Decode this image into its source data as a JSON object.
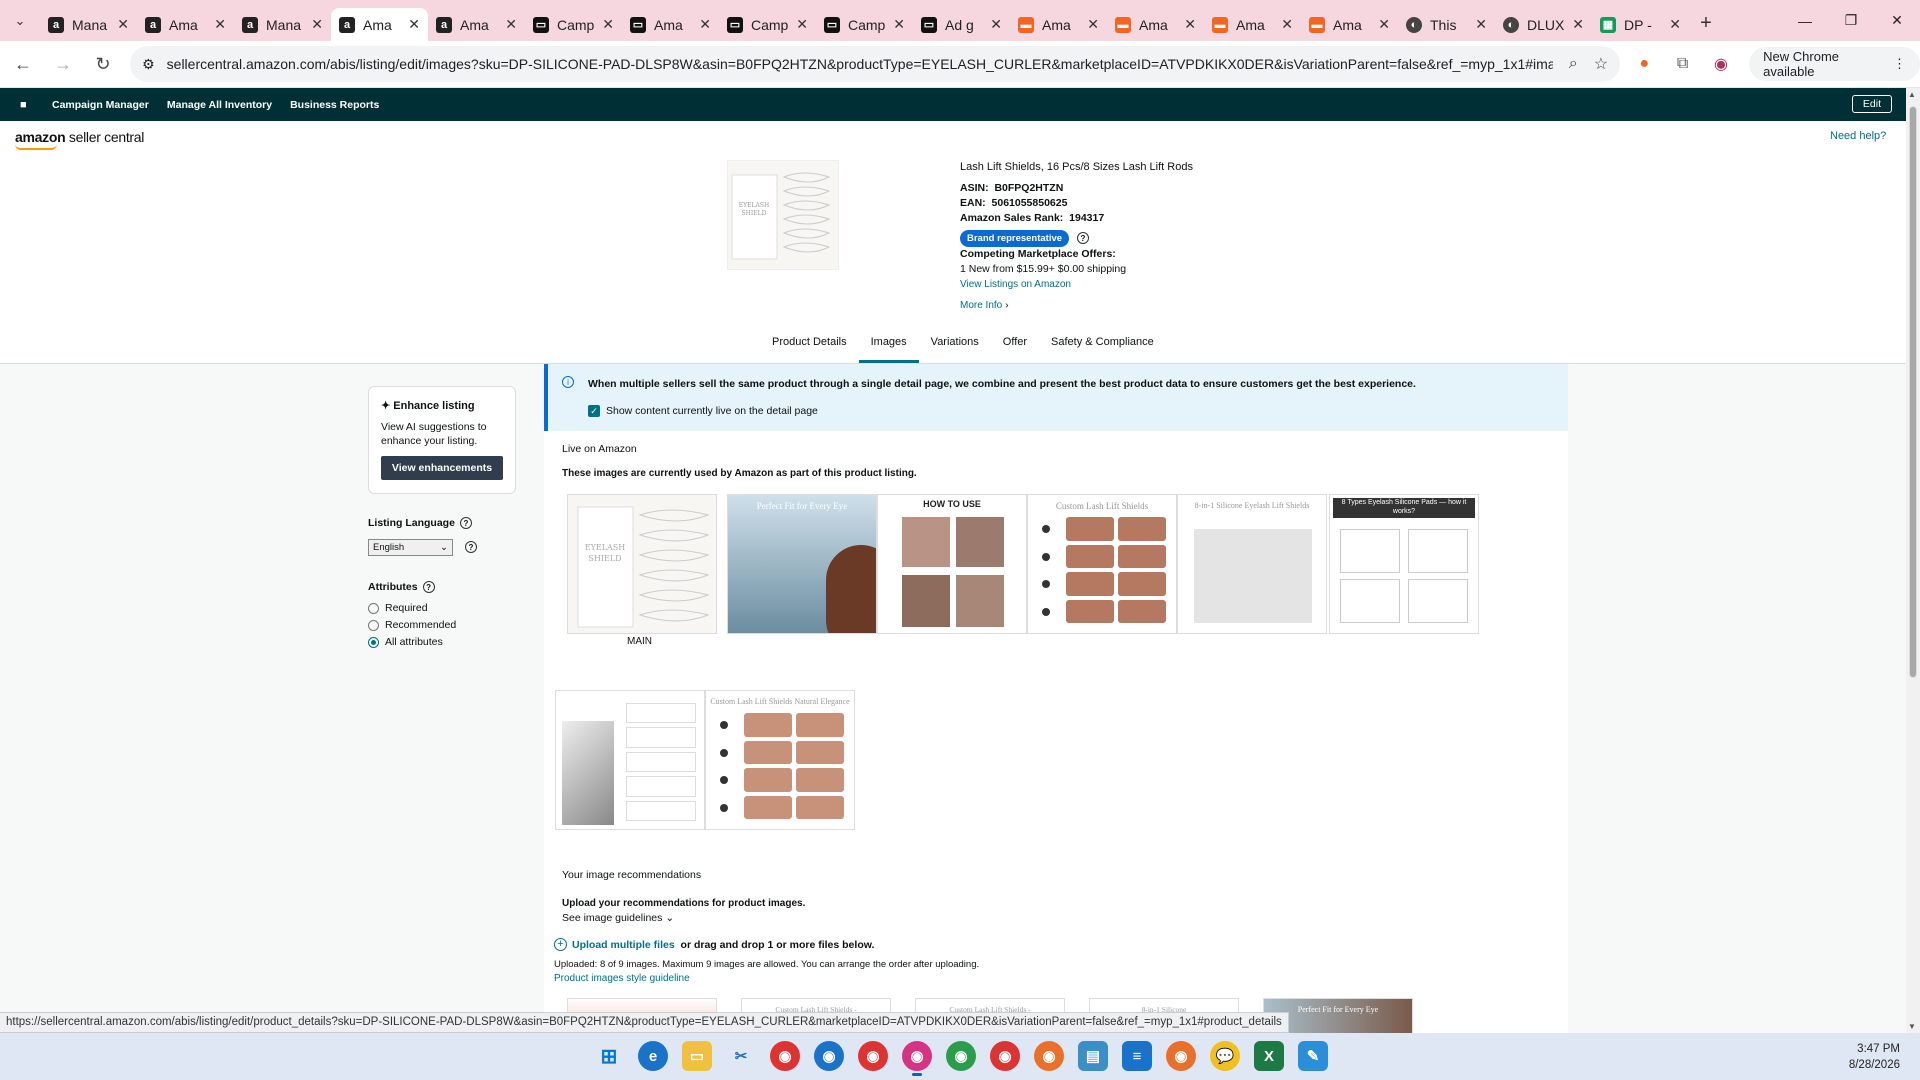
{
  "browser": {
    "tabs": [
      {
        "label": "Mana",
        "icon": "amazon",
        "color": "#222"
      },
      {
        "label": "Ama",
        "icon": "amazon",
        "color": "#222"
      },
      {
        "label": "Mana",
        "icon": "amazon",
        "color": "#222"
      },
      {
        "label": "Ama",
        "icon": "amazon",
        "color": "#222",
        "active": true
      },
      {
        "label": "Ama",
        "icon": "amazon",
        "color": "#222"
      },
      {
        "label": "Camp",
        "icon": "sc",
        "color": "#222"
      },
      {
        "label": "Ama",
        "icon": "sc",
        "color": "#222"
      },
      {
        "label": "Camp",
        "icon": "sc",
        "color": "#222"
      },
      {
        "label": "Camp",
        "icon": "sc",
        "color": "#222"
      },
      {
        "label": "Ad g",
        "icon": "sc",
        "color": "#222"
      },
      {
        "label": "Ama",
        "icon": "orange",
        "color": "#f26522"
      },
      {
        "label": "Ama",
        "icon": "orange",
        "color": "#f26522"
      },
      {
        "label": "Ama",
        "icon": "orange",
        "color": "#f26522"
      },
      {
        "label": "Ama",
        "icon": "orange",
        "color": "#f26522"
      },
      {
        "label": "This",
        "icon": "circle",
        "color": "#444"
      },
      {
        "label": "DLUX",
        "icon": "circle",
        "color": "#444"
      },
      {
        "label": "DP -",
        "icon": "sheets",
        "color": "#0f9d58"
      }
    ],
    "url": "sellercentral.amazon.com/abis/listing/edit/images?sku=DP-SILICONE-PAD-DLSP8W&asin=B0FPQ2HTZN&productType=EYELASH_CURLER&marketplaceID=ATVPDKIKX0DER&isVariationParent=false&ref_=myp_1x1#images",
    "update_label": "New Chrome available",
    "status_url": "https://sellercentral.amazon.com/abis/listing/edit/product_details?sku=DP-SILICONE-PAD-DLSP8W&asin=B0FPQ2HTZN&productType=EYELASH_CURLER&marketplaceID=ATVPDKIKX0DER&isVariationParent=false&ref_=myp_1x1#product_details"
  },
  "scnav": {
    "items": [
      "Campaign Manager",
      "Manage All Inventory",
      "Business Reports"
    ],
    "edit": "Edit"
  },
  "header": {
    "logo_a": "amazon",
    "logo_b": "seller central",
    "need_help": "Need help?"
  },
  "product": {
    "title": "Lash Lift Shields, 16 Pcs/8 Sizes Lash Lift Rods",
    "asin_label": "ASIN:",
    "asin": "B0FPQ2HTZN",
    "ean_label": "EAN:",
    "ean": "5061055850625",
    "rank_label": "Amazon Sales Rank:",
    "rank": "194317",
    "badge": "Brand representative",
    "competing": "Competing Marketplace Offers:",
    "offers": "1 New  from $15.99+ $0.00 shipping",
    "view_listings": "View Listings on Amazon",
    "more_info": "More Info"
  },
  "page_tabs": [
    "Product Details",
    "Images",
    "Variations",
    "Offer",
    "Safety & Compliance"
  ],
  "sidebar": {
    "enhance_title": "Enhance listing",
    "enhance_text": "View AI suggestions to enhance your listing.",
    "enhance_button": "View enhancements",
    "lang_label": "Listing Language",
    "lang_value": "English",
    "attr_label": "Attributes",
    "attr_options": [
      "Required",
      "Recommended",
      "All attributes"
    ],
    "attr_selected": "All attributes"
  },
  "main": {
    "info_msg": "When multiple sellers sell the same product through a single detail page, we combine and present the best product data to ensure customers get the best experience.",
    "show_live": "Show content currently live on the detail page",
    "live_title": "Live on Amazon",
    "live_desc": "These images are currently used by Amazon as part of this product listing.",
    "main_label": "MAIN",
    "image_texts": [
      "Perfect Fit for Every Eye",
      "HOW TO USE",
      "Custom Lash Lift Shields",
      "8-in-1 Silicone Eyelash Lift Shields",
      "8 Types Eyelash Silicone Pads — how it works?",
      "Custom Lash Lift Shields Natural Elegance",
      "EYELASH SHIELD"
    ],
    "recs_title": "Your image recommendations",
    "upload_head": "Upload your recommendations for product images.",
    "guidelines": "See image guidelines",
    "upload_link": "Upload multiple files",
    "upload_rest": "or drag and drop 1 or more files below.",
    "uploaded": "Uploaded: 8 of 9 images. Maximum 9 images are allowed. You can arrange the order after uploading.",
    "style_guide": "Product images style guideline",
    "bottom_texts": [
      "Custom Lash Lift Shields -",
      "Custom Lash Lift Shields -",
      "8-in-1 Silicone",
      "Perfect Fit for Every Eye"
    ]
  },
  "taskbar": {
    "time": "3:47 PM",
    "date": "8/28/2026"
  }
}
